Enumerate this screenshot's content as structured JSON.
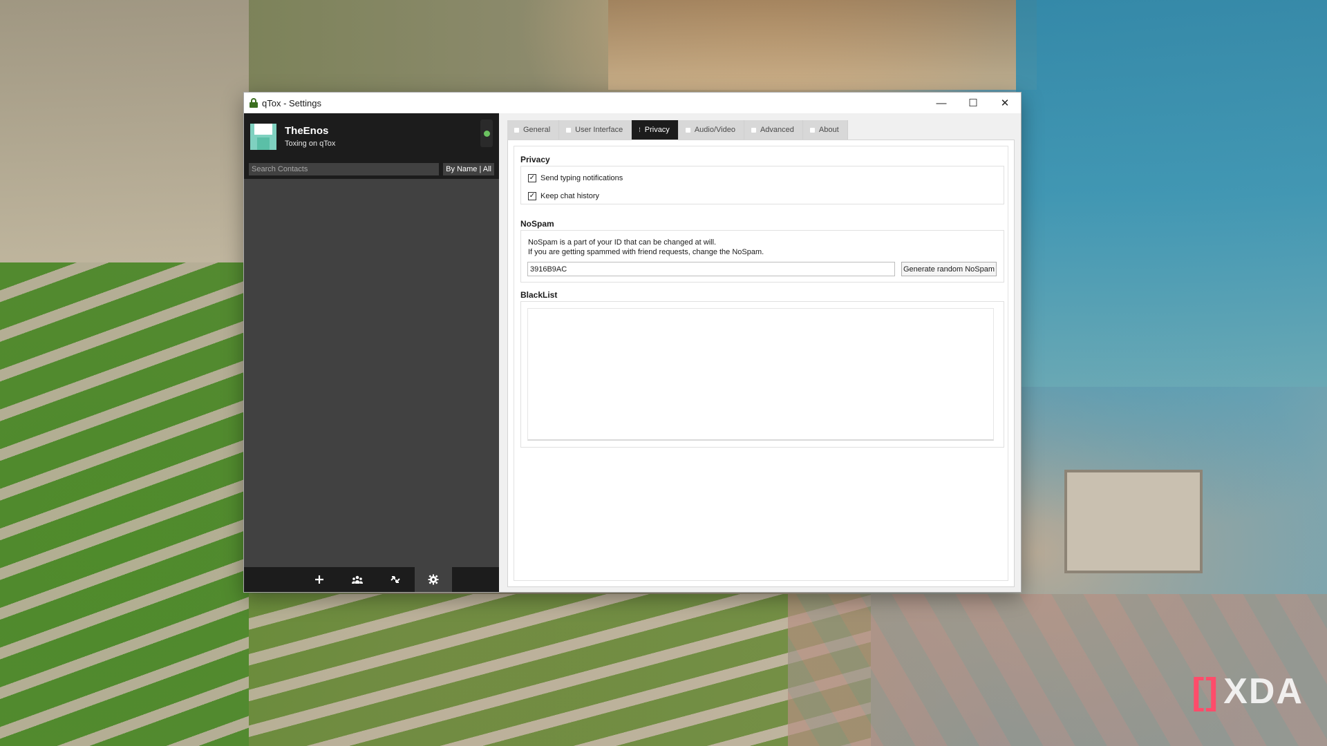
{
  "window": {
    "title": "qTox - Settings",
    "controls": {
      "minimize": "—",
      "maximize": "☐",
      "close": "✕"
    }
  },
  "profile": {
    "name": "TheEnos",
    "status_message": "Toxing on qTox",
    "status_color": "#6bc260"
  },
  "contacts": {
    "search_placeholder": "Search Contacts",
    "filter_label": "By Name | All"
  },
  "bottom_bar": {
    "buttons": [
      {
        "name": "add-friend",
        "glyph": "+"
      },
      {
        "name": "groups",
        "glyph": "👥"
      },
      {
        "name": "file-transfers",
        "glyph": "⇅"
      },
      {
        "name": "settings",
        "glyph": "⚙"
      }
    ]
  },
  "tabs": [
    {
      "label": "General",
      "active": false
    },
    {
      "label": "User Interface",
      "active": false
    },
    {
      "label": "Privacy",
      "active": true
    },
    {
      "label": "Audio/Video",
      "active": false
    },
    {
      "label": "Advanced",
      "active": false
    },
    {
      "label": "About",
      "active": false
    }
  ],
  "privacy": {
    "title": "Privacy",
    "typing_notifications": {
      "label": "Send typing notifications",
      "checked": true
    },
    "chat_history": {
      "label": "Keep chat history",
      "checked": true
    }
  },
  "nospam": {
    "title": "NoSpam",
    "description_line1": "NoSpam is a part of your ID that can be changed at will.",
    "description_line2": "If you are getting spammed with friend requests, change the NoSpam.",
    "value": "3916B9AC",
    "generate_label": "Generate random NoSpam"
  },
  "blacklist": {
    "title": "BlackList"
  },
  "watermark": {
    "text": "XDA",
    "bracket": "[]"
  }
}
